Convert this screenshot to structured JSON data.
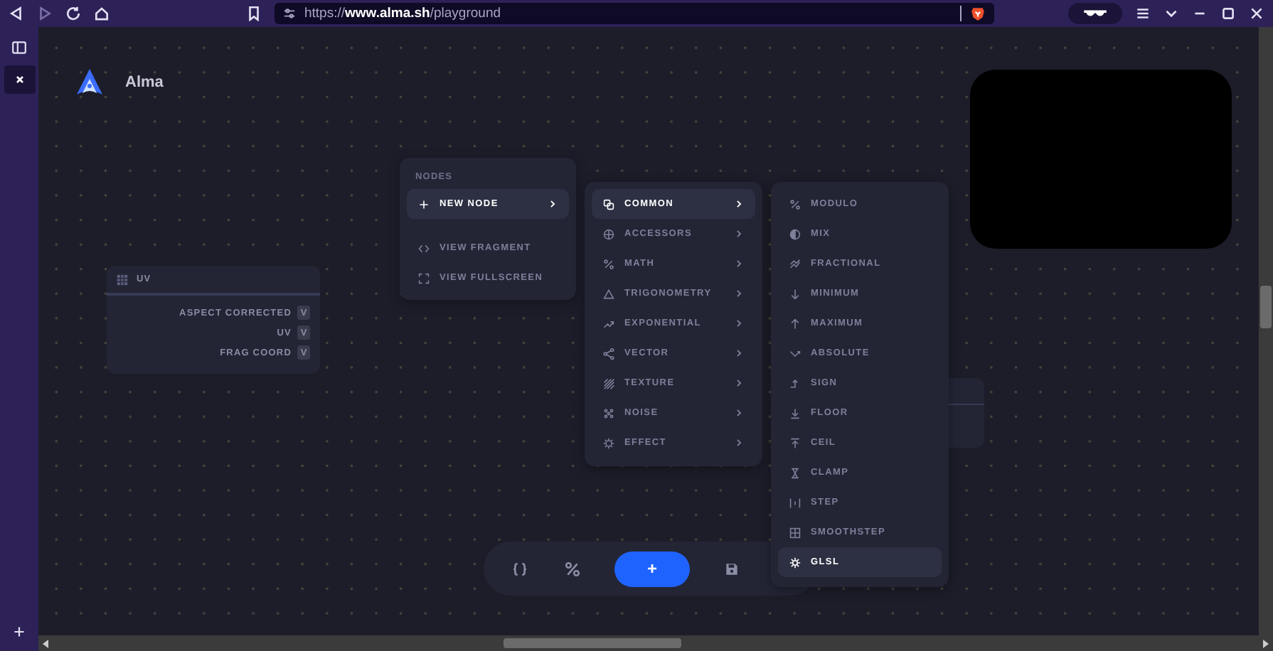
{
  "browser": {
    "url": "https://**www.alma.sh**/playground",
    "back_disabled": false,
    "forward_disabled": true
  },
  "app": {
    "name": "Alma"
  },
  "uv_node": {
    "title": "UV",
    "outputs": [
      {
        "label": "ASPECT CORRECTED",
        "type": "V"
      },
      {
        "label": "UV",
        "type": "V"
      },
      {
        "label": "FRAG COORD",
        "type": "V"
      }
    ]
  },
  "nodes_menu": {
    "heading": "NODES",
    "items": [
      {
        "label": "NEW NODE",
        "selected": true,
        "submenu": true
      },
      {
        "label": "VIEW FRAGMENT",
        "selected": false,
        "submenu": false
      },
      {
        "label": "VIEW FULLSCREEN",
        "selected": false,
        "submenu": false
      }
    ]
  },
  "category_menu": {
    "items": [
      {
        "label": "COMMON",
        "selected": true
      },
      {
        "label": "ACCESSORS",
        "selected": false
      },
      {
        "label": "MATH",
        "selected": false
      },
      {
        "label": "TRIGONOMETRY",
        "selected": false
      },
      {
        "label": "EXPONENTIAL",
        "selected": false
      },
      {
        "label": "VECTOR",
        "selected": false
      },
      {
        "label": "TEXTURE",
        "selected": false
      },
      {
        "label": "NOISE",
        "selected": false
      },
      {
        "label": "EFFECT",
        "selected": false
      }
    ]
  },
  "common_menu": {
    "items": [
      {
        "label": "MODULO",
        "selected": false
      },
      {
        "label": "MIX",
        "selected": false
      },
      {
        "label": "FRACTIONAL",
        "selected": false
      },
      {
        "label": "MINIMUM",
        "selected": false
      },
      {
        "label": "MAXIMUM",
        "selected": false
      },
      {
        "label": "ABSOLUTE",
        "selected": false
      },
      {
        "label": "SIGN",
        "selected": false
      },
      {
        "label": "FLOOR",
        "selected": false
      },
      {
        "label": "CEIL",
        "selected": false
      },
      {
        "label": "CLAMP",
        "selected": false
      },
      {
        "label": "STEP",
        "selected": false
      },
      {
        "label": "SMOOTHSTEP",
        "selected": false
      },
      {
        "label": "GLSL",
        "selected": true
      }
    ]
  },
  "toolbar": {
    "add_button": "+"
  }
}
